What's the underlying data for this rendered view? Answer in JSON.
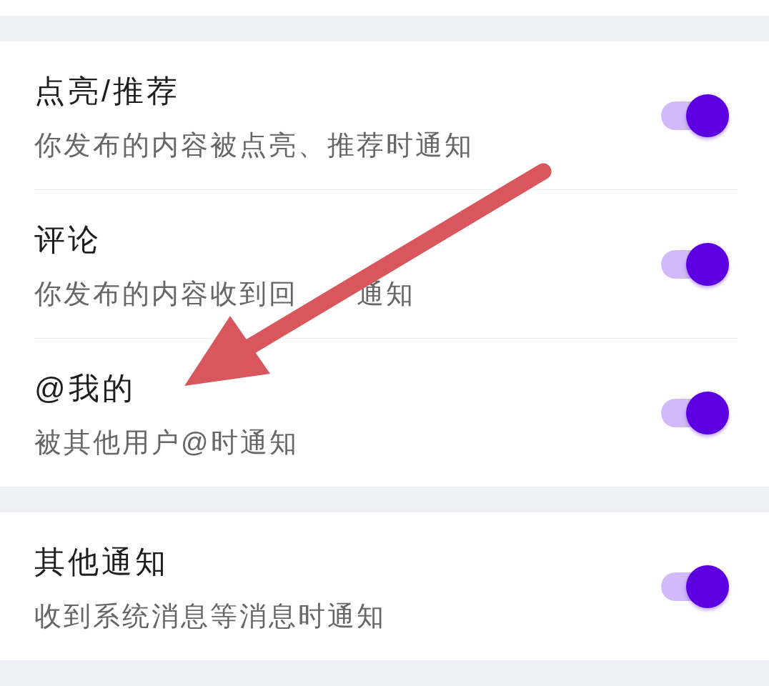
{
  "sections": [
    {
      "rows": [
        {
          "title": "点亮/推荐",
          "subtitle": [
            "你发布的内容被点亮、推荐时通知"
          ],
          "on": true
        },
        {
          "title": "评论",
          "subtitle": [
            "你发布的内容收到回",
            "通知"
          ],
          "on": true
        },
        {
          "title": "@我的",
          "subtitle": [
            "被其他用户@时通知"
          ],
          "on": true
        }
      ]
    },
    {
      "rows": [
        {
          "title": "其他通知",
          "subtitle": [
            "收到系统消息等消息时通知"
          ],
          "on": true
        }
      ]
    }
  ],
  "annotations": [
    {
      "kind": "arrow"
    }
  ]
}
